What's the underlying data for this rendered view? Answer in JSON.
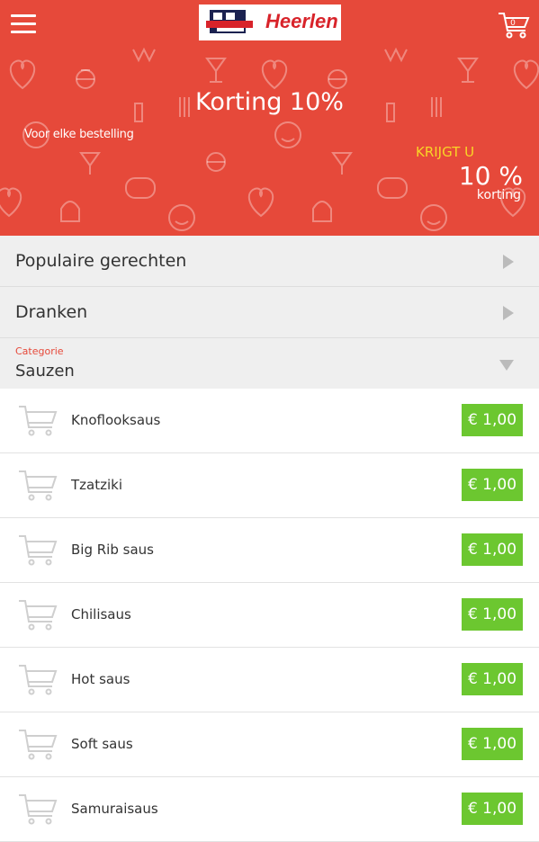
{
  "header": {
    "logo_text": "Heerlen",
    "logo_mark_text": "BIG RIB",
    "cart_count": "0",
    "menu_icon": "hamburger-icon",
    "cart_icon": "shopping-cart-icon"
  },
  "promo": {
    "title": "Korting 10%",
    "subtitle": "Voor elke bestelling",
    "get_label": "KRIJGT U",
    "percent": "10 %",
    "percent_label": "korting"
  },
  "categories": [
    {
      "label": "Populaire gerechten"
    },
    {
      "label": "Dranken"
    }
  ],
  "category_select": {
    "label": "Categorie",
    "value": "Sauzen"
  },
  "items": [
    {
      "name": "Knoflooksaus",
      "price": "€ 1,00"
    },
    {
      "name": "Tzatziki",
      "price": "€ 1,00"
    },
    {
      "name": "Big Rib saus",
      "price": "€ 1,00"
    },
    {
      "name": "Chilisaus",
      "price": "€ 1,00"
    },
    {
      "name": "Hot saus",
      "price": "€ 1,00"
    },
    {
      "name": "Soft saus",
      "price": "€ 1,00"
    },
    {
      "name": "Samuraisaus",
      "price": "€ 1,00"
    }
  ],
  "colors": {
    "brand_red": "#e6493a",
    "accent_yellow": "#f9d526",
    "price_green": "#6cc730"
  }
}
